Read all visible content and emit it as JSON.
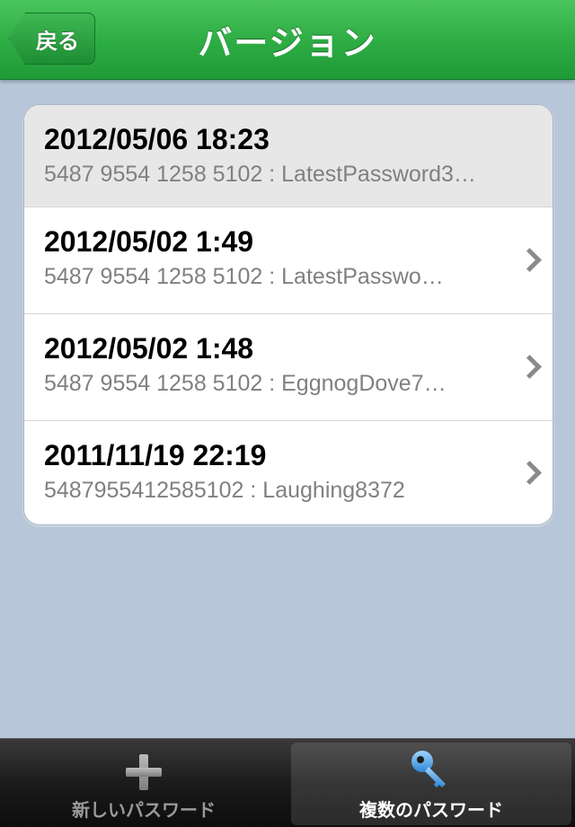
{
  "nav": {
    "back_label": "戻る",
    "title": "バージョン"
  },
  "versions": [
    {
      "date": "2012/05/06 18:23",
      "detail": "5487 9554 1258 5102 : LatestPassword3…"
    },
    {
      "date": "2012/05/02 1:49",
      "detail": "5487 9554 1258 5102 : LatestPasswo…"
    },
    {
      "date": "2012/05/02 1:48",
      "detail": "5487 9554 1258 5102 : EggnogDove7…"
    },
    {
      "date": "2011/11/19 22:19",
      "detail": "5487955412585102 : Laughing8372"
    }
  ],
  "tabs": [
    {
      "label": "新しいパスワード",
      "icon": "plus-icon",
      "selected": false
    },
    {
      "label": "複数のパスワード",
      "icon": "key-icon",
      "selected": true
    }
  ],
  "colors": {
    "navbar": "#2fae45",
    "background": "#b8c6d9",
    "key_icon": "#4aa6e8"
  }
}
